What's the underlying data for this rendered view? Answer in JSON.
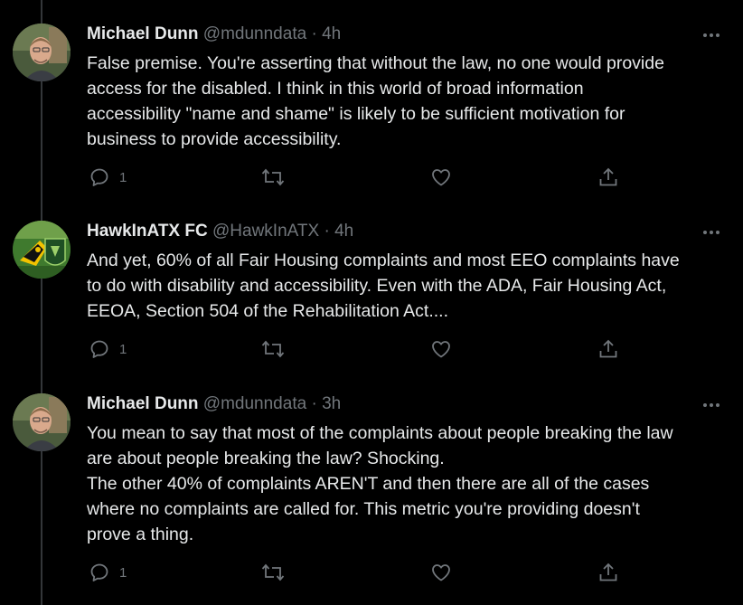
{
  "tweets": [
    {
      "name": "Michael Dunn",
      "handle": "@mdunndata",
      "separator": "·",
      "time": "4h",
      "lines": [
        "False premise. You're asserting that without the law, no one would provide",
        "access for the disabled. I think in this world of broad information",
        "accessibility \"name and shame\" is likely to be sufficient motivation for",
        "business to provide accessibility."
      ],
      "reply_count": "1"
    },
    {
      "name": "HawkInATX FC",
      "handle": "@HawkInATX",
      "separator": "·",
      "time": "4h",
      "lines": [
        "And yet, 60% of all Fair Housing complaints and most EEO complaints have",
        "to do with disability and accessibility. Even with the ADA, Fair Housing Act,",
        "EEOA, Section 504 of the Rehabilitation Act...."
      ],
      "reply_count": "1"
    },
    {
      "name": "Michael Dunn",
      "handle": "@mdunndata",
      "separator": "·",
      "time": "3h",
      "lines": [
        "You mean to say that most of the complaints about people breaking the law",
        "are about people breaking the law? Shocking.",
        "The other 40% of complaints AREN'T and then there are all of the cases",
        "where no complaints are called for. This metric you're providing doesn't",
        "prove a thing."
      ],
      "reply_count": "1"
    }
  ],
  "icons": {
    "reply": "reply-icon",
    "retweet": "retweet-icon",
    "like": "heart-icon",
    "share": "share-icon",
    "more": "more-icon"
  },
  "colors": {
    "background": "#000000",
    "text": "#e7e9ea",
    "secondary": "#71767b",
    "thread_line": "#333639"
  }
}
